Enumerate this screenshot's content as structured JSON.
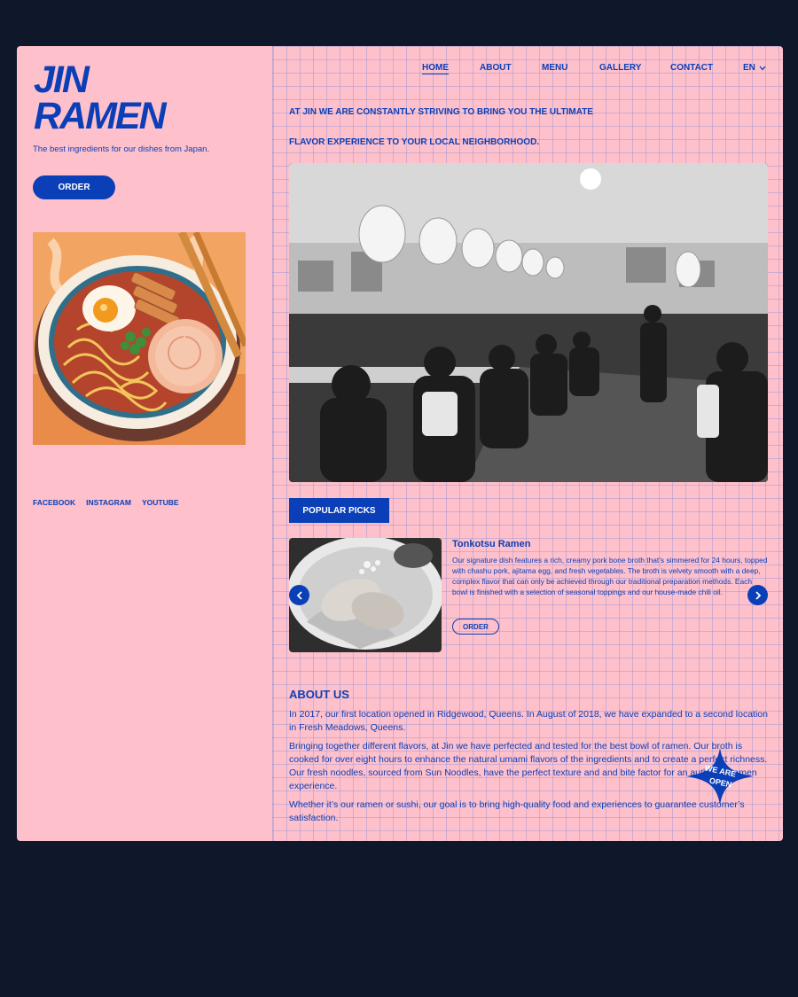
{
  "brand": {
    "logo_line1": "JIN",
    "logo_line2": "RAMEN",
    "tagline": "The best ingredients for our dishes from Japan.",
    "order_label": "ORDER"
  },
  "social": [
    "FACEBOOK",
    "INSTAGRAM",
    "YOUTUBE"
  ],
  "nav": {
    "items": [
      "HOME",
      "ABOUT",
      "MENU",
      "GALLERY",
      "CONTACT"
    ],
    "active": "HOME",
    "language": "EN"
  },
  "headline": {
    "line1": "AT JIN WE ARE CONSTANTLY STRIVING TO BRING YOU THE ULTIMATE",
    "line2": "FLAVOR EXPERIENCE TO YOUR LOCAL NEIGHBORHOOD."
  },
  "popular": {
    "button_label": "POPULAR PICKS",
    "dish_name": "Tonkotsu Ramen",
    "dish_description": "Our signature dish features a rich, creamy pork bone broth that’s simmered for 24 hours, topped with chashu pork, ajitama egg, and fresh vegetables. The broth is velvety smooth with a deep, complex flavor that can only be achieved through our traditional preparation methods. Each bowl is finished with a selection of seasonal toppings and our house-made chili oil.",
    "order_label": "ORDER"
  },
  "about": {
    "title": "ABOUT US",
    "paragraphs": [
      "In 2017, our first location opened in Ridgewood, Queens. In August of 2018, we have expanded to a second location in Fresh Meadows, Queens.",
      "Bringing together different flavors, at Jin we have perfected and tested for the best bowl of ramen. Our broth is cooked for over eight hours to enhance the natural umami flavors of the ingredients and to create a perfect richness. Our fresh noodles, sourced from Sun Noodles, have the perfect texture and and bite factor for an authentic ramen experience.",
      "Whether it’s our ramen or sushi, our goal is to bring high-quality food and experiences to guarantee customer’s satisfaction."
    ]
  },
  "badge": {
    "line1": "WE ARE",
    "line2": "OPEN"
  },
  "colors": {
    "accent": "#0b3fb8",
    "card_background": "#fec0cb",
    "page_background": "#0f172a"
  }
}
